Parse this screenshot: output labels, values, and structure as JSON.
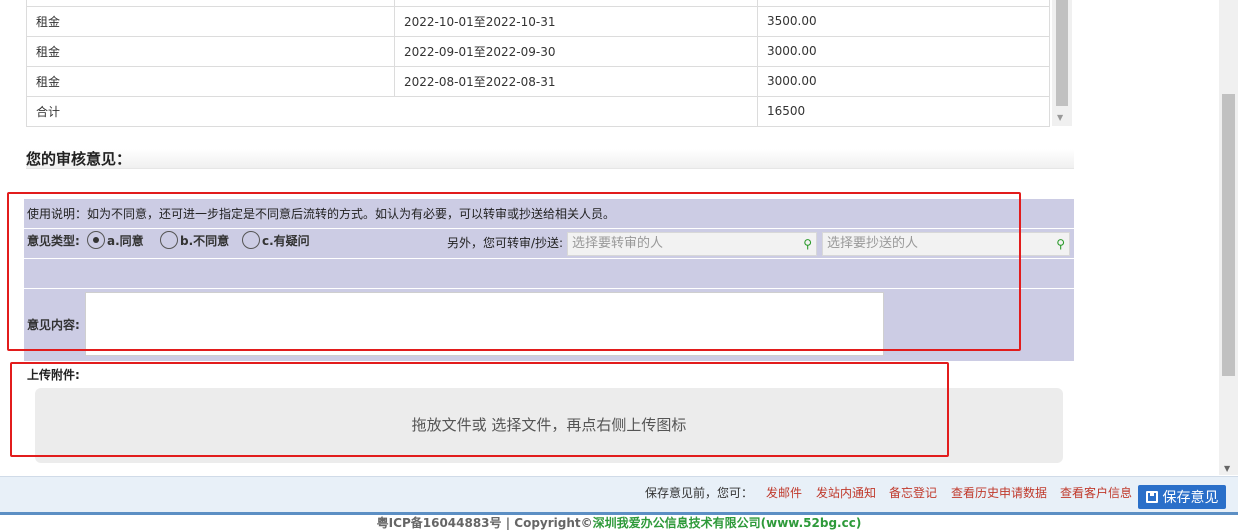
{
  "fee_table": {
    "rows": [
      {
        "item": "",
        "period": "",
        "amount": ""
      },
      {
        "item": "租金",
        "period": "2022-10-01至2022-10-31",
        "amount": "3500.00"
      },
      {
        "item": "租金",
        "period": "2022-09-01至2022-09-30",
        "amount": "3000.00"
      },
      {
        "item": "租金",
        "period": "2022-08-01至2022-08-31",
        "amount": "3000.00"
      }
    ],
    "total_label": "合计",
    "total_value": "16500"
  },
  "review": {
    "section_title": "您的审核意见：",
    "usage_note": "使用说明：如为不同意，还可进一步指定是不同意后流转的方式。如认为有必要，可以转审或抄送给相关人员。",
    "opinion_type_label": "意见类型:",
    "options": [
      {
        "label": "a.同意",
        "selected": true
      },
      {
        "label": "b.不同意",
        "selected": false
      },
      {
        "label": "c.有疑问",
        "selected": false
      }
    ],
    "forward_label": "另外，您可转审/抄送:",
    "forward_placeholder": "选择要转审的人",
    "cc_placeholder": "选择要抄送的人",
    "content_label": "意见内容:",
    "content_value": ""
  },
  "upload": {
    "label": "上传附件:",
    "drop_text_pre": "拖放文件或 ",
    "choose_link": "选择文件",
    "drop_text_post": "，再点右侧上传图标"
  },
  "actions": {
    "before_label": "保存意见前，您可：",
    "links": [
      "发邮件",
      "发站内通知",
      "备忘登记",
      "查看历史申请数据",
      "查看客户信息"
    ],
    "save_label": "保存意见"
  },
  "footer": {
    "icp": "粤ICP备16044883号 |  Copyright©",
    "company": "深圳我爱办公信息技术有限公司(www.52bg.cc)"
  },
  "colors": {
    "panel_bg": "#cccce4",
    "highlight": "#e21c1c",
    "link_red": "#c0392b",
    "save_button": "#2a6fc9"
  },
  "icons": [
    "search-icon",
    "save-disk-icon",
    "scroll-down-arrow-icon"
  ]
}
